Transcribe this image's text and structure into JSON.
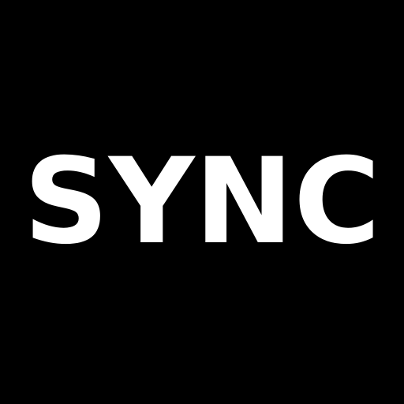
{
  "app": {
    "logo_text": "SYNC",
    "background_color": "#000000",
    "text_color": "#ffffff"
  }
}
